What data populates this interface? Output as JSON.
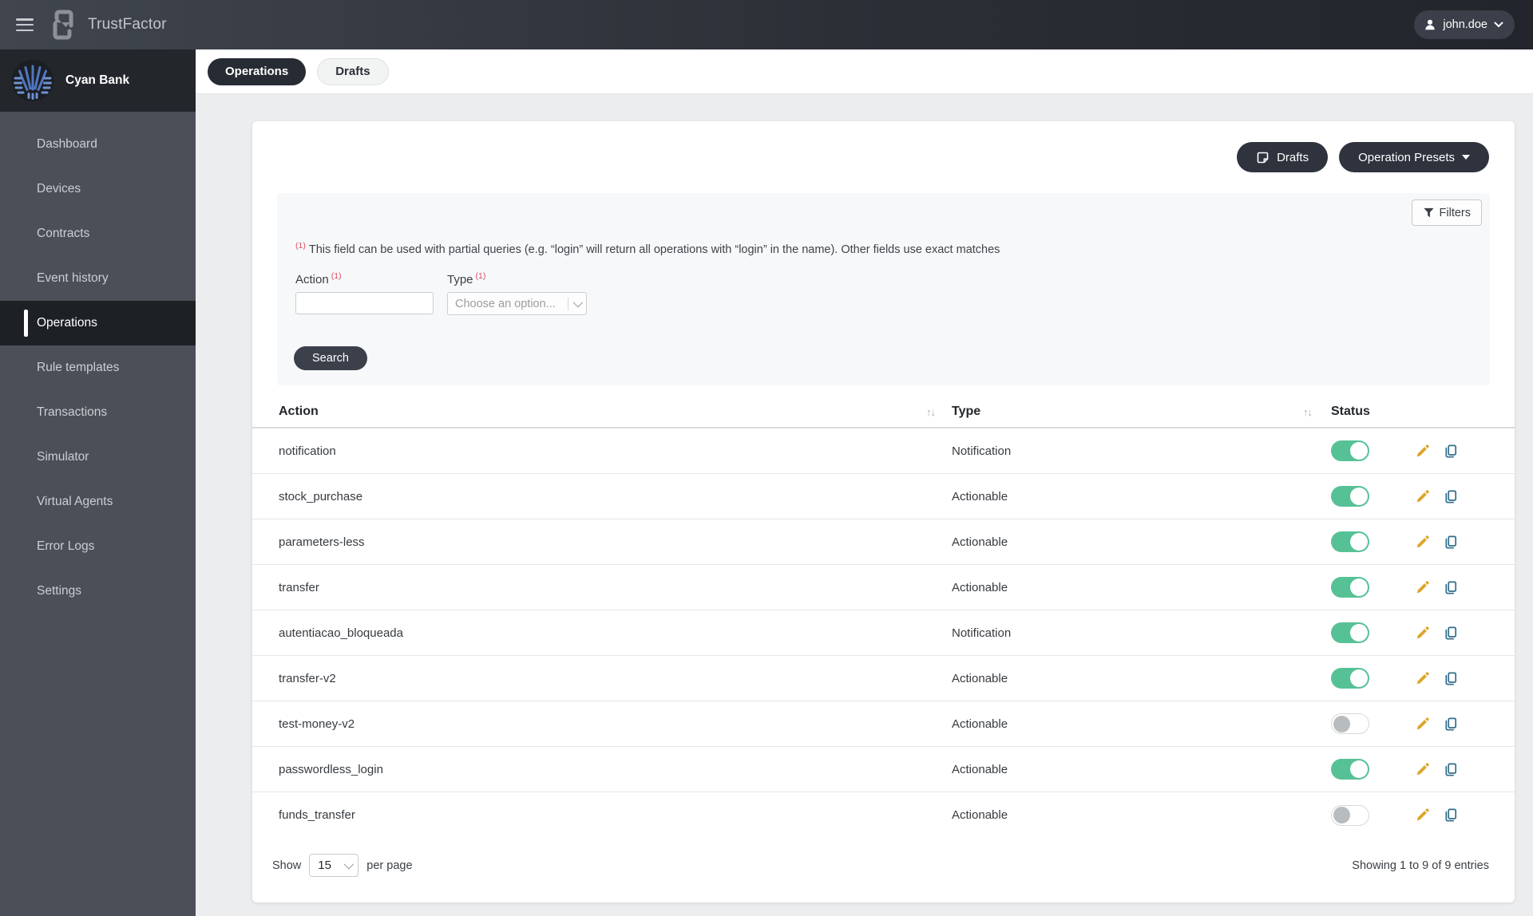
{
  "colors": {
    "accent_dark": "#2e333d",
    "toggle_on_green": "#57c196",
    "pencil_amber": "#dca62c",
    "copy_blue": "#2f6d8c",
    "superscript_red": "#e14b63",
    "sidebar_bg": "#4a4f58",
    "logo_blue": "#5077c0"
  },
  "topbar": {
    "app_name": "TrustFactor",
    "user_label": "john.doe"
  },
  "sidebar": {
    "bank_name": "Cyan Bank",
    "items": [
      {
        "label": "Dashboard",
        "active": false
      },
      {
        "label": "Devices",
        "active": false
      },
      {
        "label": "Contracts",
        "active": false
      },
      {
        "label": "Event history",
        "active": false
      },
      {
        "label": "Operations",
        "active": true
      },
      {
        "label": "Rule templates",
        "active": false
      },
      {
        "label": "Transactions",
        "active": false
      },
      {
        "label": "Simulator",
        "active": false
      },
      {
        "label": "Virtual Agents",
        "active": false
      },
      {
        "label": "Error Logs",
        "active": false
      },
      {
        "label": "Settings",
        "active": false
      }
    ]
  },
  "tabs": [
    {
      "label": "Operations",
      "active": true
    },
    {
      "label": "Drafts",
      "active": false
    }
  ],
  "toolbar": {
    "drafts_label": "Drafts",
    "presets_label": "Operation Presets"
  },
  "filters": {
    "button_label": "Filters",
    "sup": "(1)",
    "note": "This field can be used with partial queries (e.g. “login” will return all operations with “login” in the name). Other fields use exact matches",
    "action_label": "Action",
    "action_value": "",
    "type_label": "Type",
    "type_placeholder": "Choose an option...",
    "search_label": "Search"
  },
  "table": {
    "headers": {
      "action": "Action",
      "type": "Type",
      "status": "Status"
    },
    "sort_glyph": "↑↓",
    "rows": [
      {
        "action": "notification",
        "type": "Notification",
        "enabled": true
      },
      {
        "action": "stock_purchase",
        "type": "Actionable",
        "enabled": true
      },
      {
        "action": "parameters-less",
        "type": "Actionable",
        "enabled": true
      },
      {
        "action": "transfer",
        "type": "Actionable",
        "enabled": true
      },
      {
        "action": "autentiacao_bloqueada",
        "type": "Notification",
        "enabled": true
      },
      {
        "action": "transfer-v2",
        "type": "Actionable",
        "enabled": true
      },
      {
        "action": "test-money-v2",
        "type": "Actionable",
        "enabled": false
      },
      {
        "action": "passwordless_login",
        "type": "Actionable",
        "enabled": true
      },
      {
        "action": "funds_transfer",
        "type": "Actionable",
        "enabled": false
      }
    ]
  },
  "pagination": {
    "show_label": "Show",
    "page_size": "15",
    "per_page_label": "per page",
    "summary": "Showing 1 to 9 of 9 entries"
  }
}
